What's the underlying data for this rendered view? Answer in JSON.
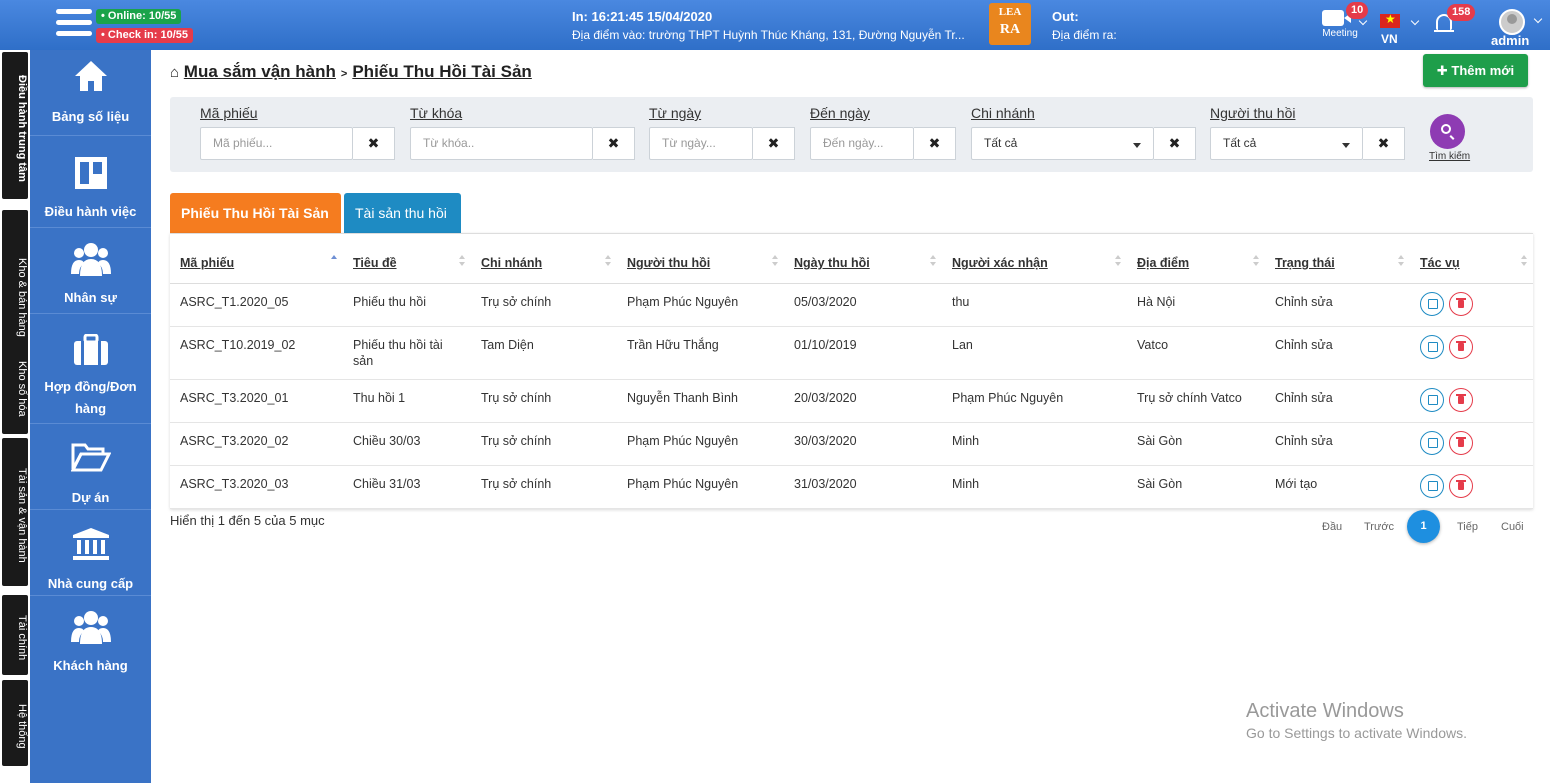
{
  "topbar": {
    "online": "Online: 10/55",
    "checkin": "Check in: 10/55",
    "in_time": "In: 16:21:45 15/04/2020",
    "in_location": "Địa điểm vào: trường THPT Huỳnh Thúc Kháng, 131, Đường Nguyễn Tr...",
    "logo_top": "LEA",
    "logo_bottom": "RA",
    "out_label": "Out:",
    "out_location": "Địa điểm ra:",
    "meeting_label": "Meeting",
    "meeting_count": "10",
    "lang": "VN",
    "notif_count": "158",
    "user": "admin"
  },
  "vtabs": [
    {
      "label": "Điều hành trung tâm",
      "icon": "gear-icon"
    },
    {
      "label": "Kho & bán hàng",
      "icon": "box-icon"
    },
    {
      "label": "Kho số hóa",
      "icon": "wifi-icon"
    },
    {
      "label": "Tài sản & vận hành",
      "icon": "cubes-icon"
    },
    {
      "label": "Tài chính",
      "icon": "chart-icon"
    },
    {
      "label": "Hệ thống",
      "icon": "edit-icon"
    }
  ],
  "sidebar": [
    {
      "label": "Bảng số liệu",
      "icon": "home-icon"
    },
    {
      "label": "Điều hành việc",
      "icon": "board-icon"
    },
    {
      "label": "Nhân sự",
      "icon": "users-icon"
    },
    {
      "label": "Hợp đồng/Đơn hàng",
      "icon": "briefcase-icon"
    },
    {
      "label": "Dự án",
      "icon": "folder-icon"
    },
    {
      "label": "Nhà cung cấp",
      "icon": "bank-icon"
    },
    {
      "label": "Khách hàng",
      "icon": "users-icon"
    }
  ],
  "breadcrumb": {
    "parent": "Mua sắm vận hành",
    "current": "Phiếu Thu Hồi Tài Sản"
  },
  "add_button": "Thêm mới",
  "filters": {
    "ma_phieu": {
      "label": "Mã phiếu",
      "placeholder": "Mã phiếu..."
    },
    "tu_khoa": {
      "label": "Từ khóa",
      "placeholder": "Từ khóa.."
    },
    "tu_ngay": {
      "label": "Từ ngày",
      "placeholder": "Từ ngày..."
    },
    "den_ngay": {
      "label": "Đến ngày",
      "placeholder": "Đến ngày..."
    },
    "chi_nhanh": {
      "label": "Chi nhánh",
      "value": "Tất cả"
    },
    "nguoi_thu_hoi": {
      "label": "Người thu hồi",
      "value": "Tất cả"
    },
    "search_label": "Tìm kiếm"
  },
  "tabs": {
    "active": "Phiếu Thu Hồi Tài Sản",
    "other": "Tài sản thu hồi"
  },
  "table": {
    "headers": [
      "Mã phiếu",
      "Tiêu đề",
      "Chi nhánh",
      "Người thu hồi",
      "Ngày thu hồi",
      "Người xác nhận",
      "Địa điểm",
      "Trạng thái",
      "Tác vụ"
    ],
    "rows": [
      [
        "ASRC_T1.2020_05",
        "Phiếu thu hồi",
        "Trụ sở chính",
        "Phạm Phúc Nguyên",
        "05/03/2020",
        "thu",
        "Hà Nội",
        "Chỉnh sửa"
      ],
      [
        "ASRC_T10.2019_02",
        "Phiếu thu hồi tài sản",
        "Tam Diện",
        "Trần Hữu Thắng",
        "01/10/2019",
        "Lan",
        "Vatco",
        "Chỉnh sửa"
      ],
      [
        "ASRC_T3.2020_01",
        "Thu hồi 1",
        "Trụ sở chính",
        "Nguyễn Thanh Bình",
        "20/03/2020",
        "Phạm Phúc Nguyên",
        "Trụ sở chính Vatco",
        "Chỉnh sửa"
      ],
      [
        "ASRC_T3.2020_02",
        "Chiều 30/03",
        "Trụ sở chính",
        "Phạm Phúc Nguyên",
        "30/03/2020",
        "Minh",
        "Sài Gòn",
        "Chỉnh sửa"
      ],
      [
        "ASRC_T3.2020_03",
        "Chiều 31/03",
        "Trụ sở chính",
        "Phạm Phúc Nguyên",
        "31/03/2020",
        "Minh",
        "Sài Gòn",
        "Mới tạo"
      ]
    ]
  },
  "info": "Hiển thị 1 đến 5 của 5 mục",
  "pagination": {
    "first": "Đầu",
    "prev": "Trước",
    "current": "1",
    "next": "Tiếp",
    "last": "Cuối"
  },
  "watermark": {
    "line1": "Activate Windows",
    "line2": "Go to Settings to activate Windows."
  }
}
